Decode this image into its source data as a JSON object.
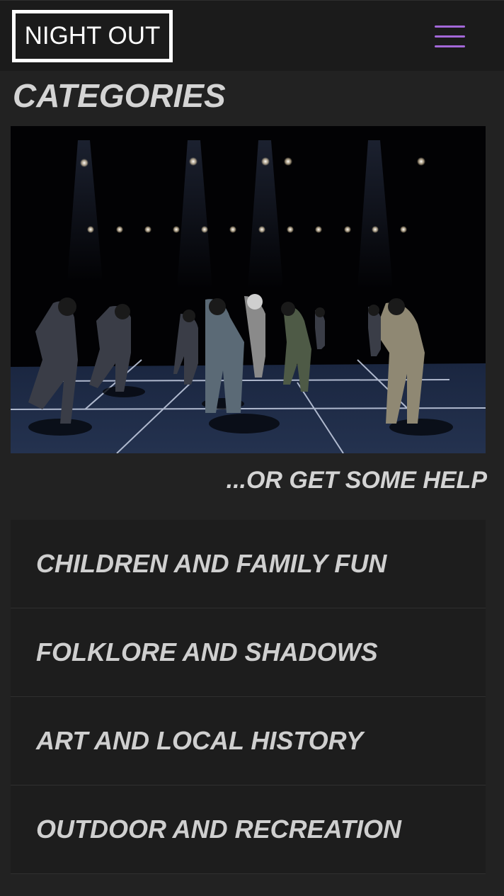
{
  "header": {
    "logo_text": "NIGHT OUT",
    "menu_icon": "hamburger-menu-icon",
    "menu_color": "#a368d8"
  },
  "page": {
    "title": "CATEGORIES",
    "hero_image": "dancers-on-stage-photo",
    "help_link": "...OR GET SOME HELP"
  },
  "categories": [
    {
      "label": "CHILDREN AND FAMILY FUN"
    },
    {
      "label": "FOLKLORE AND SHADOWS"
    },
    {
      "label": "ART AND LOCAL HISTORY"
    },
    {
      "label": "OUTDOOR AND RECREATION"
    }
  ]
}
